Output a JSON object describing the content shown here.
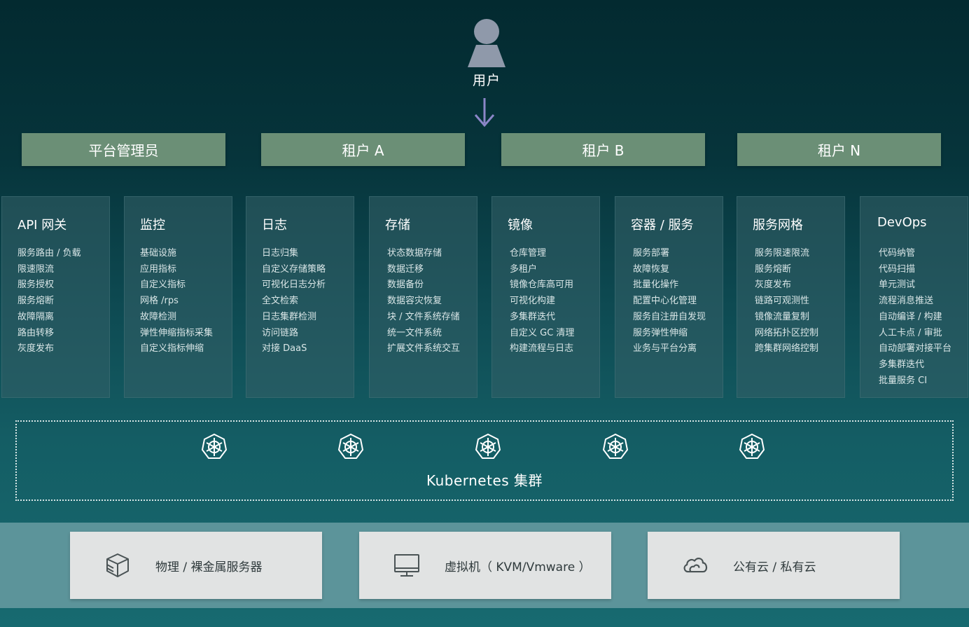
{
  "user": {
    "label": "用户"
  },
  "tenants": [
    "平台管理员",
    "租户 A",
    "租户 B",
    "租户 N"
  ],
  "modules": [
    {
      "title": "API 网关",
      "items": [
        "服务路由 / 负载",
        "限速限流",
        "服务授权",
        "服务熔断",
        "故障隔离",
        "路由转移",
        "灰度发布"
      ]
    },
    {
      "title": "监控",
      "items": [
        "基础设施",
        "应用指标",
        "自定义指标",
        "网格 /rps",
        "故障检测",
        "弹性伸缩指标采集",
        "自定义指标伸缩"
      ]
    },
    {
      "title": "日志",
      "items": [
        "日志归集",
        "自定义存储策略",
        "可视化日志分析",
        "全文检索",
        "日志集群检测",
        "访问链路",
        "对接 DaaS"
      ]
    },
    {
      "title": "存储",
      "items": [
        "状态数据存储",
        "数据迁移",
        "数据备份",
        "数据容灾恢复",
        "块 / 文件系统存储",
        "统一文件系统",
        "扩展文件系统交互"
      ]
    },
    {
      "title": "镜像",
      "items": [
        "仓库管理",
        "多租户",
        "镜像仓库高可用",
        "可视化构建",
        "多集群迭代",
        "自定义 GC 清理",
        "构建流程与日志"
      ]
    },
    {
      "title": "容器 / 服务",
      "items": [
        "服务部署",
        "故障恢复",
        "批量化操作",
        "配置中心化管理",
        "服务自注册自发现",
        "服务弹性伸缩",
        "业务与平台分离"
      ]
    },
    {
      "title": "服务网格",
      "items": [
        "服务限速限流",
        "服务熔断",
        "灰度发布",
        "链路可观测性",
        "镜像流量复制",
        "网络拓扑区控制",
        "跨集群网络控制"
      ]
    },
    {
      "title": "DevOps",
      "items": [
        "代码纳管",
        "代码扫描",
        "单元测试",
        "流程消息推送",
        "自动编译 / 构建",
        "人工卡点 / 审批",
        "自动部署对接平台",
        "多集群迭代",
        "批量服务 CI"
      ]
    }
  ],
  "cluster": {
    "label": "Kubernetes 集群",
    "node_icon": "kubernetes-helm-icon"
  },
  "infrastructure": [
    {
      "label": "物理 / 裸金属服务器",
      "icon": "server-cube-icon"
    },
    {
      "label": "虚拟机（ KVM/Vmware ）",
      "icon": "monitor-icon"
    },
    {
      "label": "公有云 / 私有云",
      "icon": "cloud-icon"
    }
  ],
  "colors": {
    "tenant_bg": "#6b8f76",
    "arrow": "#8b86c8",
    "infra_band": "#5c949a",
    "infra_box": "#e1e3e3"
  }
}
